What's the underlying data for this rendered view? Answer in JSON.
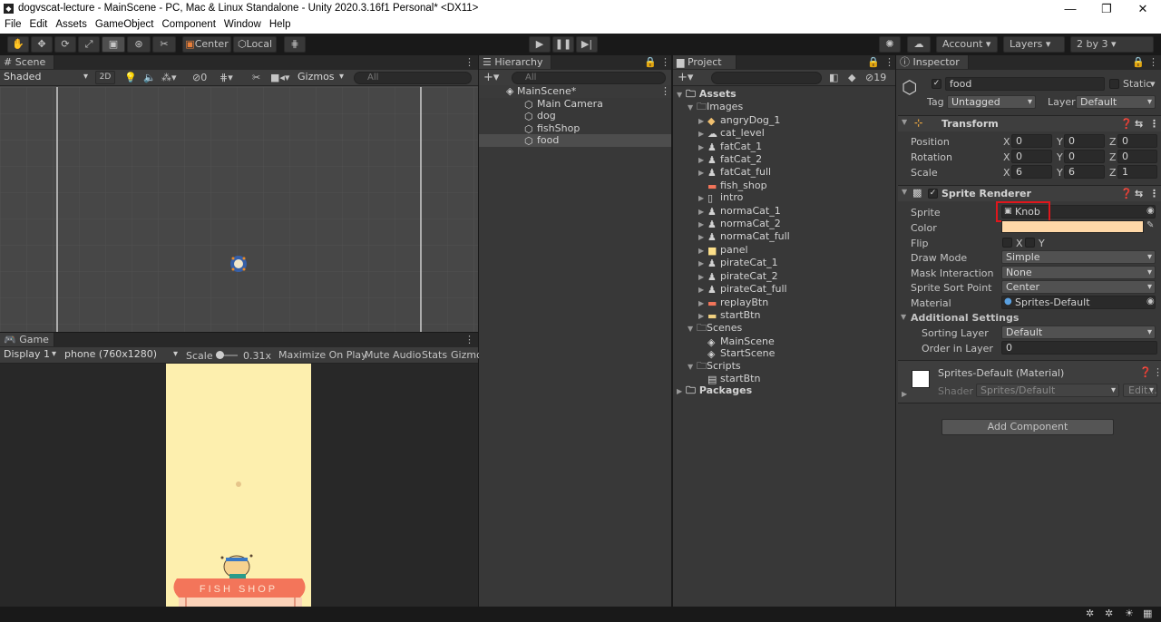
{
  "window": {
    "title": "dogvscat-lecture - MainScene - PC, Mac & Linux Standalone - Unity 2020.3.16f1 Personal* <DX11>"
  },
  "menu": [
    "File",
    "Edit",
    "Assets",
    "GameObject",
    "Component",
    "Window",
    "Help"
  ],
  "toolbar": {
    "center": "Center",
    "local": "Local",
    "account": "Account",
    "layers": "Layers",
    "layout": "2 by 3"
  },
  "scene": {
    "tab": "Scene",
    "shading": "Shaded",
    "mode2d": "2D",
    "hidden_count": "0",
    "gizmos": "Gizmos",
    "search_placeholder": "All"
  },
  "game": {
    "tab": "Game",
    "display": "Display 1",
    "resolution": "phone (760x1280)",
    "scale_label": "Scale",
    "scale_value": "0.31x",
    "maximize": "Maximize On Play",
    "mute": "Mute Audio",
    "stats": "Stats",
    "gizmos": "Gizmo",
    "shop_sign": "FISH SHOP",
    "colors": {
      "background": "#fdefae",
      "awning": "#f3755a"
    }
  },
  "hierarchy": {
    "tab": "Hierarchy",
    "search_placeholder": "All",
    "scene": "MainScene*",
    "items": [
      "Main Camera",
      "dog",
      "fishShop",
      "food"
    ],
    "selected": "food"
  },
  "project": {
    "tab": "Project",
    "hidden_count": "19",
    "assets": "Assets",
    "images_folder": "Images",
    "images": [
      "angryDog_1",
      "cat_level",
      "fatCat_1",
      "fatCat_2",
      "fatCat_full",
      "fish_shop",
      "intro",
      "normaCat_1",
      "normaCat_2",
      "normaCat_full",
      "panel",
      "pirateCat_1",
      "pirateCat_2",
      "pirateCat_full",
      "replayBtn",
      "startBtn"
    ],
    "scenes_folder": "Scenes",
    "scenes": [
      "MainScene",
      "StartScene"
    ],
    "scripts_folder": "Scripts",
    "scripts": [
      "startBtn"
    ],
    "packages": "Packages"
  },
  "inspector": {
    "tab": "Inspector",
    "object_name": "food",
    "static_label": "Static",
    "tag_label": "Tag",
    "tag": "Untagged",
    "layer_label": "Layer",
    "layer": "Default",
    "transform": {
      "title": "Transform",
      "position_label": "Position",
      "rotation_label": "Rotation",
      "scale_label": "Scale",
      "axes": [
        "X",
        "Y",
        "Z"
      ],
      "position": [
        "0",
        "0",
        "0"
      ],
      "rotation": [
        "0",
        "0",
        "0"
      ],
      "scale": [
        "6",
        "6",
        "1"
      ]
    },
    "sprite_renderer": {
      "title": "Sprite Renderer",
      "sprite_label": "Sprite",
      "sprite": "Knob",
      "color_label": "Color",
      "color": "#ffd8a8",
      "flip_label": "Flip",
      "flip_x": "X",
      "flip_y": "Y",
      "draw_mode_label": "Draw Mode",
      "draw_mode": "Simple",
      "mask_label": "Mask Interaction",
      "mask": "None",
      "sort_point_label": "Sprite Sort Point",
      "sort_point": "Center",
      "material_label": "Material",
      "material": "Sprites-Default",
      "additional": "Additional Settings",
      "sorting_layer_label": "Sorting Layer",
      "sorting_layer": "Default",
      "order_label": "Order in Layer",
      "order": "0"
    },
    "material_section": {
      "title": "Sprites-Default (Material)",
      "shader_label": "Shader",
      "shader": "Sprites/Default",
      "edit": "Edit..."
    },
    "add_component": "Add Component"
  },
  "colors": {
    "highlight": "#e0161c",
    "selection": "#4d4d4d"
  }
}
